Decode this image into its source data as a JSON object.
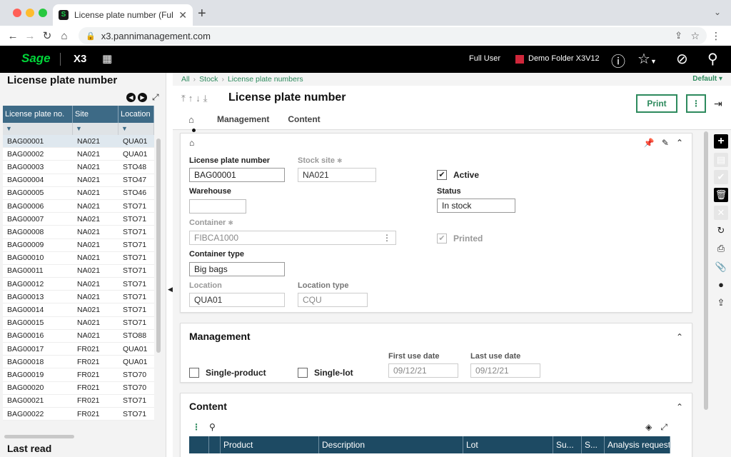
{
  "browser": {
    "tab_title": "License plate number (Full Use",
    "url": "x3.pannimanagement.com"
  },
  "app": {
    "logo": "Sage",
    "product": "X3",
    "user": "Full User",
    "folder": "Demo Folder X3V12",
    "folder_color": "#d0273b"
  },
  "left": {
    "title": "License plate number",
    "columns": [
      "License plate no.",
      "Site",
      "Location"
    ],
    "rows": [
      [
        "BAG00001",
        "NA021",
        "QUA01"
      ],
      [
        "BAG00002",
        "NA021",
        "QUA01"
      ],
      [
        "BAG00003",
        "NA021",
        "STO48"
      ],
      [
        "BAG00004",
        "NA021",
        "STO47"
      ],
      [
        "BAG00005",
        "NA021",
        "STO46"
      ],
      [
        "BAG00006",
        "NA021",
        "STO71"
      ],
      [
        "BAG00007",
        "NA021",
        "STO71"
      ],
      [
        "BAG00008",
        "NA021",
        "STO71"
      ],
      [
        "BAG00009",
        "NA021",
        "STO71"
      ],
      [
        "BAG00010",
        "NA021",
        "STO71"
      ],
      [
        "BAG00011",
        "NA021",
        "STO71"
      ],
      [
        "BAG00012",
        "NA021",
        "STO71"
      ],
      [
        "BAG00013",
        "NA021",
        "STO71"
      ],
      [
        "BAG00014",
        "NA021",
        "STO71"
      ],
      [
        "BAG00015",
        "NA021",
        "STO71"
      ],
      [
        "BAG00016",
        "NA021",
        "STO88"
      ],
      [
        "BAG00017",
        "FR021",
        "QUA01"
      ],
      [
        "BAG00018",
        "FR021",
        "QUA01"
      ],
      [
        "BAG00019",
        "FR021",
        "STO70"
      ],
      [
        "BAG00020",
        "FR021",
        "STO70"
      ],
      [
        "BAG00021",
        "FR021",
        "STO71"
      ],
      [
        "BAG00022",
        "FR021",
        "STO71"
      ]
    ],
    "last_read": "Last read"
  },
  "breadcrumb": [
    "All",
    "Stock",
    "License plate numbers"
  ],
  "default_label": "Default",
  "page_title": "License plate number",
  "print_label": "Print",
  "tabs": [
    "Management",
    "Content"
  ],
  "form": {
    "lpn_label": "License plate number",
    "lpn_value": "BAG00001",
    "site_label": "Stock site",
    "site_value": "NA021",
    "active_label": "Active",
    "warehouse_label": "Warehouse",
    "warehouse_value": "",
    "status_label": "Status",
    "status_value": "In stock",
    "container_label": "Container",
    "container_value": "FIBCA1000",
    "printed_label": "Printed",
    "container_type_label": "Container type",
    "container_type_value": "Big bags",
    "location_label": "Location",
    "location_value": "QUA01",
    "location_type_label": "Location type",
    "location_type_value": "CQU"
  },
  "management": {
    "title": "Management",
    "single_product": "Single-product",
    "single_lot": "Single-lot",
    "first_use_label": "First use date",
    "first_use_value": "09/12/21",
    "last_use_label": "Last use date",
    "last_use_value": "09/12/21"
  },
  "content": {
    "title": "Content",
    "columns": [
      "",
      "",
      "Product",
      "Description",
      "Lot",
      "Su...",
      "S...",
      "Analysis request"
    ]
  }
}
